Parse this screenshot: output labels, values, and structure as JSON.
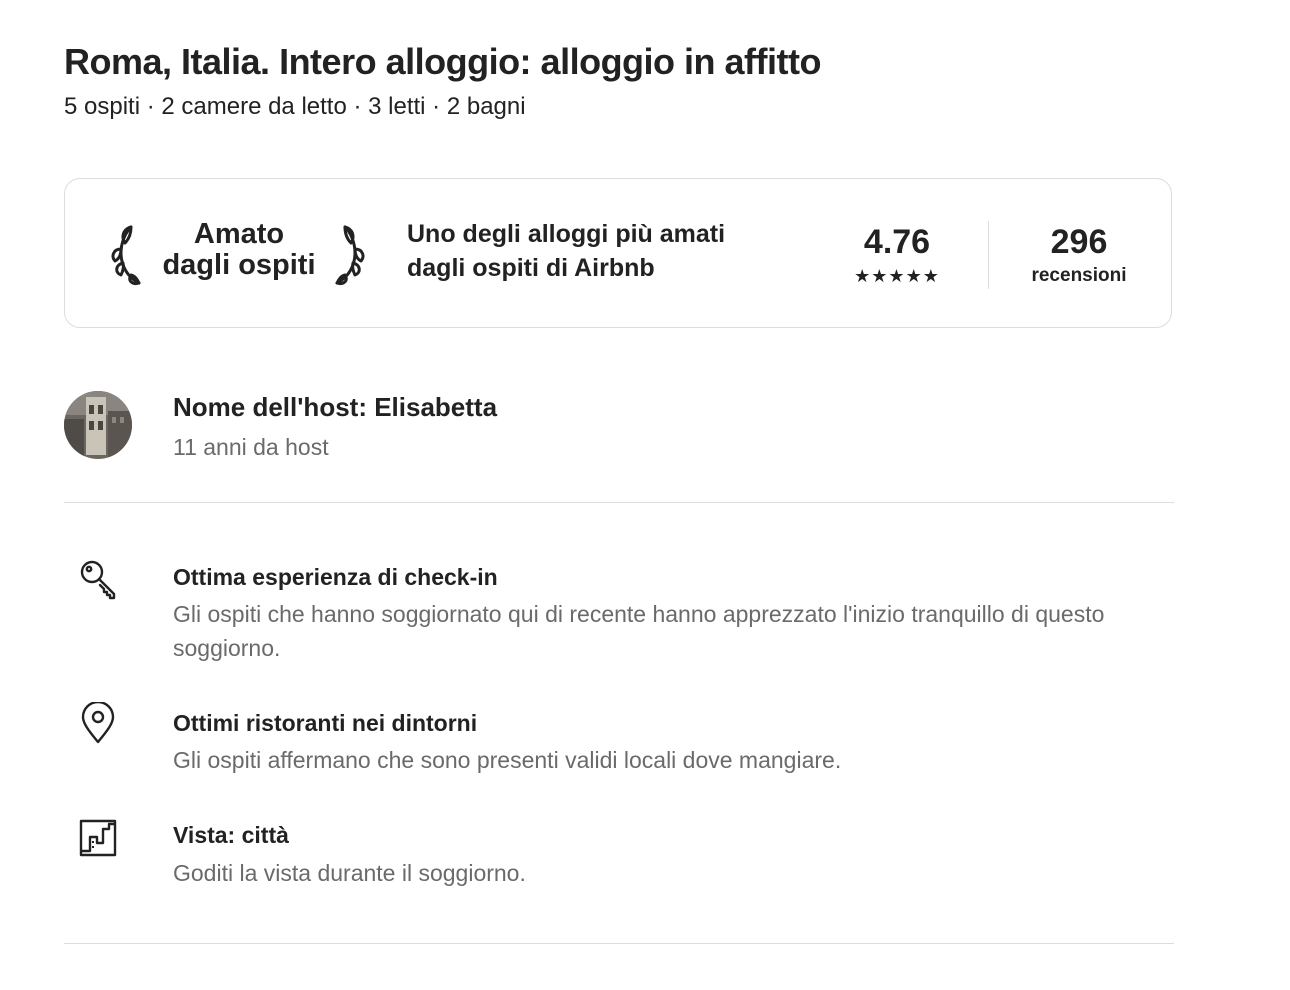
{
  "listing": {
    "title": "Roma, Italia. Intero alloggio: alloggio in affitto",
    "summary": "5 ospiti · 2 camere da letto · 3 letti · 2 bagni"
  },
  "guest_favorite": {
    "badge_line1": "Amato",
    "badge_line2": "dagli ospiti",
    "description": "Uno degli alloggi più amati dagli ospiti di Airbnb",
    "rating": "4.76",
    "stars": "★★★★★",
    "rating_stars_value": 5,
    "reviews_count": "296",
    "reviews_label": "recensioni",
    "icon": "laurel-icon"
  },
  "host": {
    "name": "Nome dell'host: Elisabetta",
    "years": "11 anni da host"
  },
  "highlights": [
    {
      "icon": "key-icon",
      "title": "Ottima esperienza di check-in",
      "description": "Gli ospiti che hanno soggiornato qui di recente hanno apprezzato l'inizio tranquillo di questo soggiorno."
    },
    {
      "icon": "map-pin-icon",
      "title": "Ottimi ristoranti nei dintorni",
      "description": "Gli ospiti affermano che sono presenti validi locali dove mangiare."
    },
    {
      "icon": "city-view-icon",
      "title": "Vista: città",
      "description": "Goditi la vista durante il soggiorno."
    }
  ],
  "colors": {
    "text_primary": "#222222",
    "text_secondary": "#6a6a6a",
    "border": "#dddddd"
  }
}
